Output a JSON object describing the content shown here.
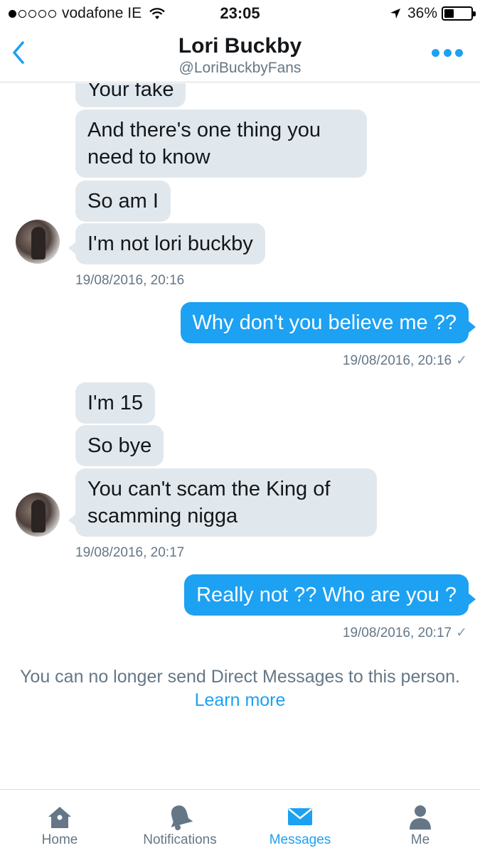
{
  "status_bar": {
    "carrier": "vodafone IE",
    "signal_dots_filled": 1,
    "signal_dots_total": 5,
    "time": "23:05",
    "battery_percent": "36%",
    "battery_level": 0.36
  },
  "header": {
    "title": "Lori Buckby",
    "subtitle": "@LoriBuckbyFans"
  },
  "messages": [
    {
      "direction": "in",
      "text": "Your fake"
    },
    {
      "direction": "in",
      "text": "And there's one thing you need to know"
    },
    {
      "direction": "in",
      "text": "So am I"
    },
    {
      "direction": "in",
      "text": "I'm not lori buckby"
    },
    {
      "direction": "in",
      "timestamp": "19/08/2016, 20:16"
    },
    {
      "direction": "out",
      "text": "Why don't you believe me ??"
    },
    {
      "direction": "out",
      "timestamp": "19/08/2016, 20:16"
    },
    {
      "direction": "in",
      "text": "I'm 15"
    },
    {
      "direction": "in",
      "text": "So bye"
    },
    {
      "direction": "in",
      "text": "You can't scam the King of scamming nigga"
    },
    {
      "direction": "in",
      "timestamp": "19/08/2016, 20:17"
    },
    {
      "direction": "out",
      "text": "Really not ?? Who are you ?"
    },
    {
      "direction": "out",
      "timestamp": "19/08/2016, 20:17"
    }
  ],
  "blocked_notice": {
    "text": "You can no longer send Direct Messages to this person.",
    "link": "Learn more"
  },
  "tab_bar": {
    "tabs": [
      {
        "label": "Home",
        "icon": "home-icon"
      },
      {
        "label": "Notifications",
        "icon": "bell-icon"
      },
      {
        "label": "Messages",
        "icon": "envelope-icon",
        "active": true
      },
      {
        "label": "Me",
        "icon": "person-icon"
      }
    ]
  },
  "colors": {
    "accent": "#1da1f2",
    "incoming_bubble": "#e1e8ed",
    "secondary_text": "#657786"
  }
}
